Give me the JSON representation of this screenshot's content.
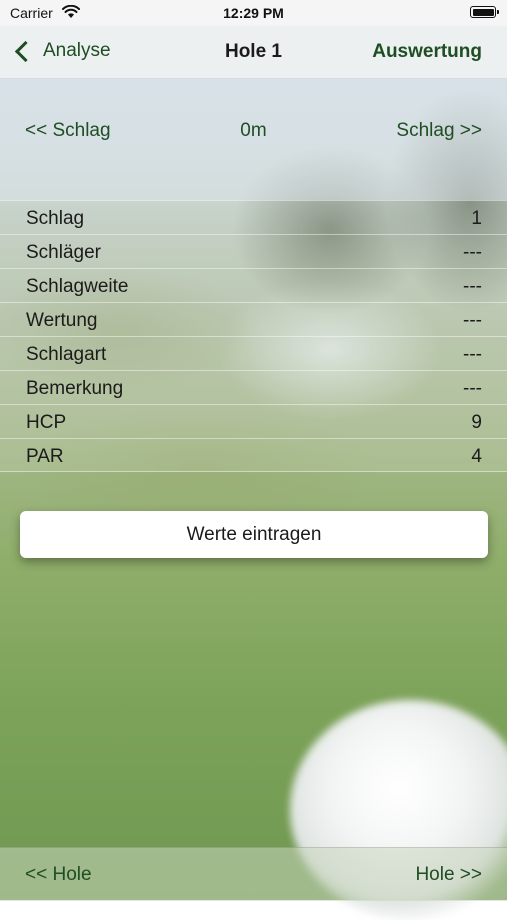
{
  "status_bar": {
    "carrier": "Carrier",
    "time": "12:29 PM",
    "wifi_icon": "wifi-icon",
    "battery_icon": "battery-icon"
  },
  "nav": {
    "back_label": "Analyse",
    "title": "Hole 1",
    "right_label": "Auswertung",
    "back_icon": "chevron-left-icon"
  },
  "shot_nav": {
    "prev_label": "<< Schlag",
    "distance": "0m",
    "next_label": "Schlag >>"
  },
  "details": [
    {
      "label": "Schlag",
      "value": "1"
    },
    {
      "label": "Schläger",
      "value": "---"
    },
    {
      "label": "Schlagweite",
      "value": "---"
    },
    {
      "label": "Wertung",
      "value": "---"
    },
    {
      "label": "Schlagart",
      "value": "---"
    },
    {
      "label": "Bemerkung",
      "value": "---"
    },
    {
      "label": "HCP",
      "value": "9"
    },
    {
      "label": "PAR",
      "value": "4"
    }
  ],
  "actions": {
    "enter_values_label": "Werte eintragen"
  },
  "bottom_bar": {
    "prev_hole_label": "<< Hole",
    "next_hole_label": "Hole >>"
  },
  "colors": {
    "accent": "#1f4d24",
    "text": "#1b1b1b"
  }
}
